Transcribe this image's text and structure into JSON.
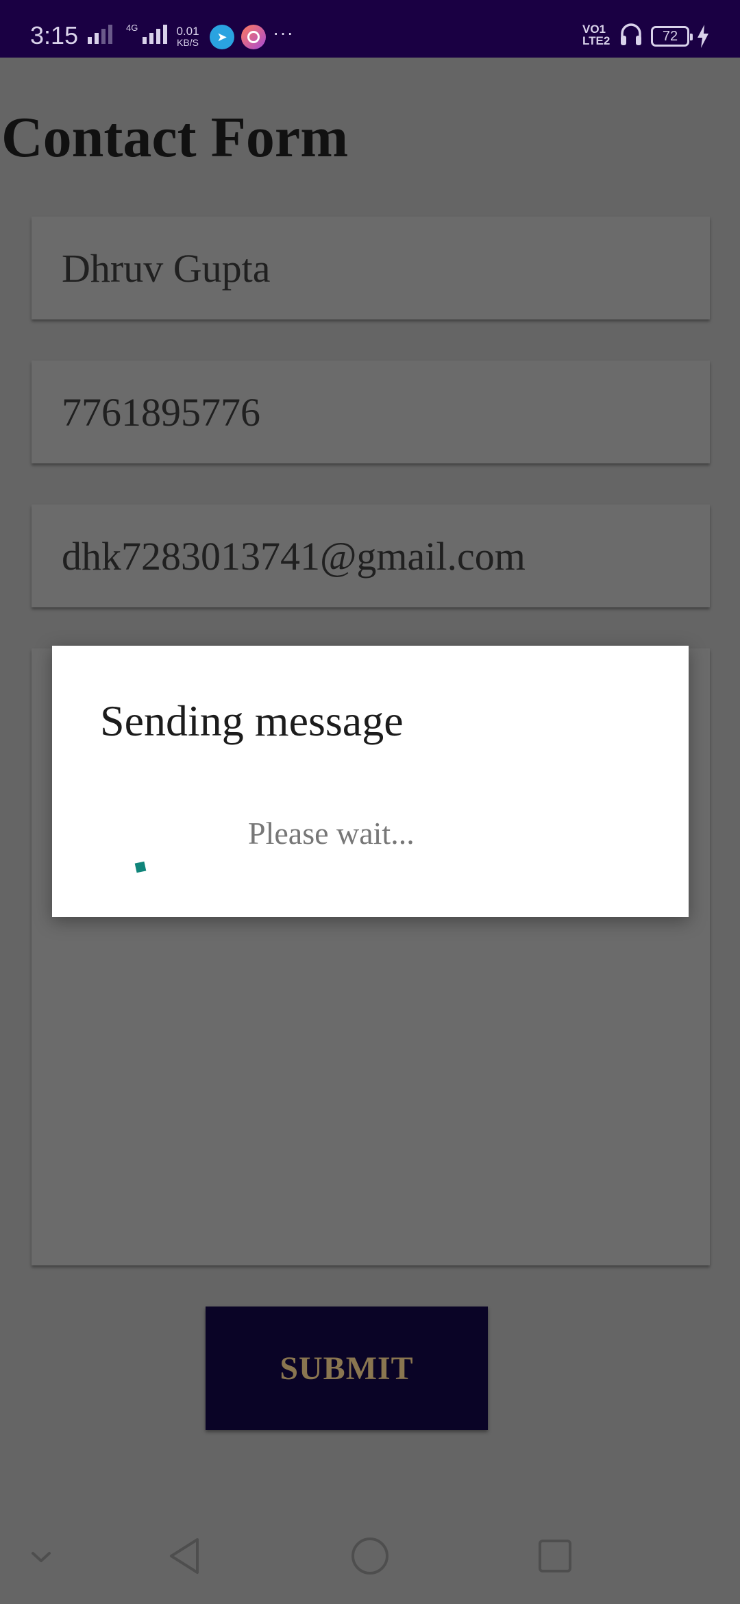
{
  "status_bar": {
    "time": "3:15",
    "network": "4G",
    "speed_value": "0.01",
    "speed_unit": "KB/S",
    "volte_top": "VO1",
    "volte_bottom": "LTE2",
    "battery": "72",
    "icons": [
      "signal-icon",
      "telegram-icon",
      "app-icon",
      "more-dots-icon",
      "headset-icon",
      "battery-icon",
      "charging-bolt-icon"
    ]
  },
  "page": {
    "title": "Contact Form"
  },
  "form": {
    "name_value": "Dhruv Gupta",
    "phone_value": "7761895776",
    "email_value": "dhk7283013741@gmail.com",
    "message_value": "",
    "submit_label": "SUBMIT"
  },
  "dialog": {
    "title": "Sending message",
    "message": "Please wait...",
    "spinner_color": "#10857a"
  },
  "nav_bar": {
    "icons": [
      "collapse-chevron-icon",
      "back-triangle-icon",
      "home-circle-icon",
      "recents-square-icon"
    ]
  },
  "colors": {
    "status_bar": "#1a0043",
    "scrim_background": "#656565",
    "submit_background": "#0a0426",
    "submit_text": "#8a7650"
  }
}
